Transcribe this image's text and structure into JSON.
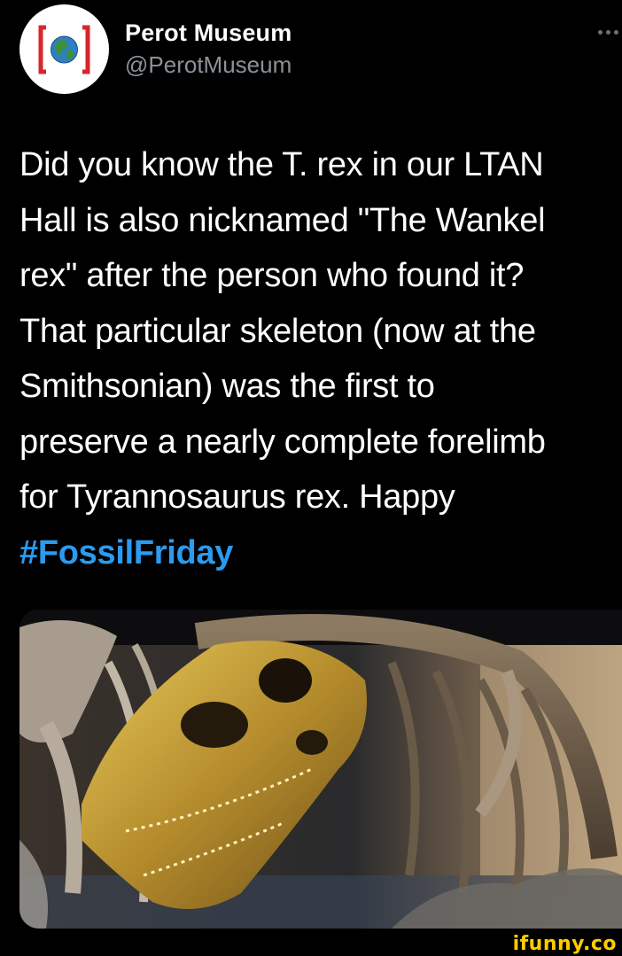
{
  "account": {
    "display_name": "Perot Museum",
    "handle": "@PerotMuseum",
    "avatar_icon": "globe-in-brackets-logo"
  },
  "more_icon": "ellipsis-icon",
  "tweet": {
    "lines": [
      "Did you know the T. rex in our LTAN",
      "Hall is also nicknamed \"The Wankel",
      "rex\" after the person who found it?",
      "That particular skeleton (now at the",
      "Smithsonian) was the first to",
      "preserve a nearly complete forelimb",
      "for Tyrannosaurus rex. Happy"
    ],
    "hashtag": "#FossilFriday"
  },
  "photo": {
    "subject": "t-rex-skeleton-photo"
  },
  "watermark": {
    "text": "ifunny.co"
  },
  "colors": {
    "background": "#000000",
    "hashtag": "#2b9bf0",
    "handle": "#8b9299",
    "watermark": "#ffcc00",
    "logo_red": "#d8262d"
  }
}
